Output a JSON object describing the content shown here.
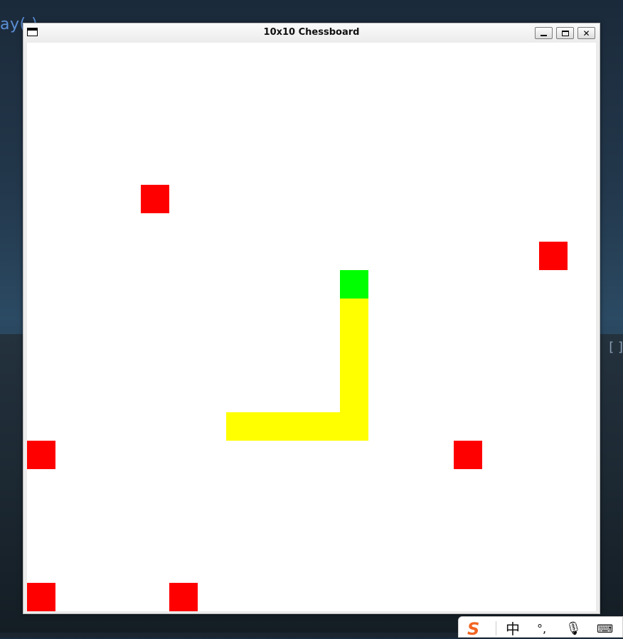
{
  "background": {
    "partial_text": "ay",
    "partial_icon": "( )",
    "corner_glyph": "[ ]"
  },
  "window": {
    "title": "10x10 Chessboard",
    "controls": {
      "minimize": "_",
      "maximize": "□",
      "close": "✕"
    }
  },
  "board": {
    "size": 10,
    "colors": {
      "empty": "#ffffff",
      "red": "#ff0000",
      "yellow": "#ffff00",
      "green": "#00ff00"
    },
    "red_cells": [
      [
        4,
        5
      ],
      [
        18,
        7
      ],
      [
        15,
        14
      ],
      [
        0,
        14
      ],
      [
        0,
        19
      ],
      [
        5,
        19
      ]
    ],
    "yellow_cells": [
      [
        11,
        9
      ],
      [
        11,
        10
      ],
      [
        11,
        11
      ],
      [
        11,
        12
      ],
      [
        11,
        13
      ],
      [
        7,
        13
      ],
      [
        8,
        13
      ],
      [
        9,
        13
      ],
      [
        10,
        13
      ]
    ],
    "green_cells": [
      [
        11,
        8
      ]
    ]
  },
  "ime": {
    "logo": "S",
    "mode": "中",
    "punct": "°,",
    "mic": "🎙",
    "keyboard": "⌨"
  }
}
